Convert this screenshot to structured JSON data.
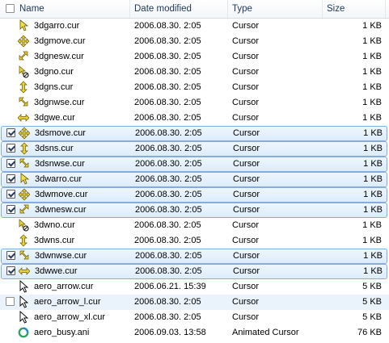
{
  "columns": {
    "name": "Name",
    "date": "Date modified",
    "type": "Type",
    "size": "Size"
  },
  "rows": [
    {
      "name": "3dgarro.cur",
      "date": "2006.08.30. 2:05",
      "type": "Cursor",
      "size": "1 KB",
      "checked": false,
      "state": "",
      "icon": "arrow-cursor-icon"
    },
    {
      "name": "3dgmove.cur",
      "date": "2006.08.30. 2:05",
      "type": "Cursor",
      "size": "1 KB",
      "checked": false,
      "state": "",
      "icon": "move-cursor-icon"
    },
    {
      "name": "3dgnesw.cur",
      "date": "2006.08.30. 2:05",
      "type": "Cursor",
      "size": "1 KB",
      "checked": false,
      "state": "",
      "icon": "resize-nesw-cursor-icon"
    },
    {
      "name": "3dgno.cur",
      "date": "2006.08.30. 2:05",
      "type": "Cursor",
      "size": "1 KB",
      "checked": false,
      "state": "",
      "icon": "unavailable-cursor-icon"
    },
    {
      "name": "3dgns.cur",
      "date": "2006.08.30. 2:05",
      "type": "Cursor",
      "size": "1 KB",
      "checked": false,
      "state": "",
      "icon": "resize-ns-cursor-icon"
    },
    {
      "name": "3dgnwse.cur",
      "date": "2006.08.30. 2:05",
      "type": "Cursor",
      "size": "1 KB",
      "checked": false,
      "state": "",
      "icon": "resize-nwse-cursor-icon"
    },
    {
      "name": "3dgwe.cur",
      "date": "2006.08.30. 2:05",
      "type": "Cursor",
      "size": "1 KB",
      "checked": false,
      "state": "",
      "icon": "resize-we-cursor-icon"
    },
    {
      "name": "3dsmove.cur",
      "date": "2006.08.30. 2:05",
      "type": "Cursor",
      "size": "1 KB",
      "checked": true,
      "state": "sel",
      "icon": "move-cursor-icon"
    },
    {
      "name": "3dsns.cur",
      "date": "2006.08.30. 2:05",
      "type": "Cursor",
      "size": "1 KB",
      "checked": true,
      "state": "sel",
      "icon": "resize-ns-cursor-icon"
    },
    {
      "name": "3dsnwse.cur",
      "date": "2006.08.30. 2:05",
      "type": "Cursor",
      "size": "1 KB",
      "checked": true,
      "state": "sel",
      "icon": "resize-nwse-cursor-icon"
    },
    {
      "name": "3dwarro.cur",
      "date": "2006.08.30. 2:05",
      "type": "Cursor",
      "size": "1 KB",
      "checked": true,
      "state": "sel",
      "icon": "arrow-cursor-icon"
    },
    {
      "name": "3dwmove.cur",
      "date": "2006.08.30. 2:05",
      "type": "Cursor",
      "size": "1 KB",
      "checked": true,
      "state": "sel",
      "icon": "move-cursor-icon"
    },
    {
      "name": "3dwnesw.cur",
      "date": "2006.08.30. 2:05",
      "type": "Cursor",
      "size": "1 KB",
      "checked": true,
      "state": "sel",
      "icon": "resize-nesw-cursor-icon"
    },
    {
      "name": "3dwno.cur",
      "date": "2006.08.30. 2:05",
      "type": "Cursor",
      "size": "1 KB",
      "checked": false,
      "state": "",
      "icon": "unavailable-cursor-icon"
    },
    {
      "name": "3dwns.cur",
      "date": "2006.08.30. 2:05",
      "type": "Cursor",
      "size": "1 KB",
      "checked": false,
      "state": "",
      "icon": "resize-ns-cursor-icon"
    },
    {
      "name": "3dwnwse.cur",
      "date": "2006.08.30. 2:05",
      "type": "Cursor",
      "size": "1 KB",
      "checked": true,
      "state": "sel",
      "icon": "resize-nwse-cursor-icon"
    },
    {
      "name": "3dwwe.cur",
      "date": "2006.08.30. 2:05",
      "type": "Cursor",
      "size": "1 KB",
      "checked": true,
      "state": "sel",
      "icon": "resize-we-cursor-icon"
    },
    {
      "name": "aero_arrow.cur",
      "date": "2006.06.21. 15:39",
      "type": "Cursor",
      "size": "5 KB",
      "checked": false,
      "state": "",
      "icon": "aero-arrow-cursor-icon"
    },
    {
      "name": "aero_arrow_l.cur",
      "date": "2006.08.30. 2:05",
      "type": "Cursor",
      "size": "5 KB",
      "checked": false,
      "state": "hl",
      "icon": "aero-arrow-cursor-icon"
    },
    {
      "name": "aero_arrow_xl.cur",
      "date": "2006.08.30. 2:05",
      "type": "Cursor",
      "size": "5 KB",
      "checked": false,
      "state": "",
      "icon": "aero-arrow-cursor-icon"
    },
    {
      "name": "aero_busy.ani",
      "date": "2006.09.03. 13:58",
      "type": "Animated Cursor",
      "size": "76 KB",
      "checked": false,
      "state": "",
      "icon": "busy-cursor-icon"
    }
  ]
}
